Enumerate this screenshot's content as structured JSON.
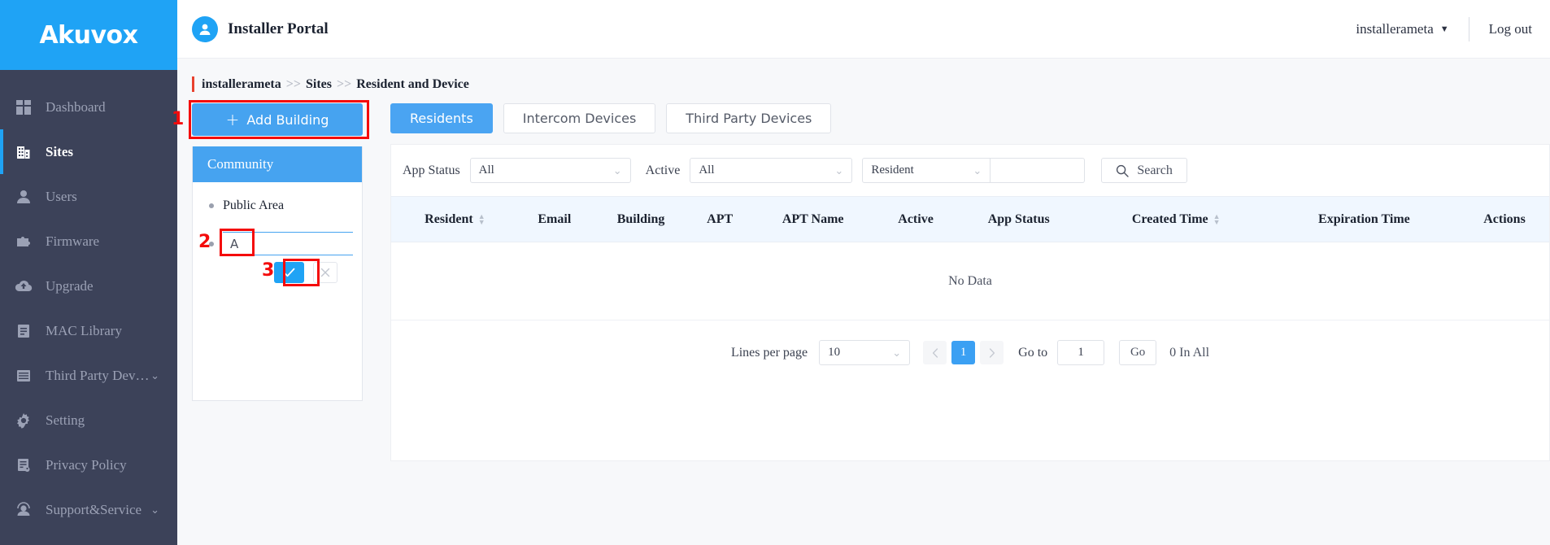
{
  "brand": {
    "logo": "Akuvox",
    "logo_bg": "#1fa3f5",
    "sidebar_bg": "#3c4259",
    "accent": "#46a3f0",
    "highlight": "#f40b0b"
  },
  "sidebar": {
    "items": [
      {
        "label": "Dashboard",
        "icon": "dashboard-icon",
        "active": false,
        "caret": ""
      },
      {
        "label": "Sites",
        "icon": "building-icon",
        "active": true,
        "caret": ""
      },
      {
        "label": "Users",
        "icon": "user-icon",
        "active": false,
        "caret": ""
      },
      {
        "label": "Firmware",
        "icon": "puzzle-icon",
        "active": false,
        "caret": ""
      },
      {
        "label": "Upgrade",
        "icon": "cloud-upload-icon",
        "active": false,
        "caret": ""
      },
      {
        "label": "MAC Library",
        "icon": "list-doc-icon",
        "active": false,
        "caret": ""
      },
      {
        "label": "Third Party Dev…",
        "icon": "grid-list-icon",
        "active": false,
        "caret": "⌄"
      },
      {
        "label": "Setting",
        "icon": "gear-icon",
        "active": false,
        "caret": ""
      },
      {
        "label": "Privacy Policy",
        "icon": "policy-doc-icon",
        "active": false,
        "caret": ""
      },
      {
        "label": "Support&Service",
        "icon": "headset-icon",
        "active": false,
        "caret": "⌄"
      }
    ]
  },
  "topbar": {
    "portal_title": "Installer Portal",
    "avatar_icon": "person-avatar-icon",
    "user_name": "installerameta",
    "caret": "▼",
    "logout": "Log out"
  },
  "breadcrumb": {
    "root": "installerameta",
    "sep": ">>",
    "middle": "Sites",
    "current": "Resident and Device"
  },
  "left": {
    "add_building_label": "Add Building",
    "add_building_plus": "+",
    "tree_header": "Community",
    "nodes": [
      {
        "label": "Public Area"
      }
    ],
    "edit_value": "A",
    "confirm_icon": "check-icon",
    "cancel_icon": "close-icon"
  },
  "steps": [
    {
      "number": "1"
    },
    {
      "number": "2"
    },
    {
      "number": "3"
    }
  ],
  "tabs": [
    {
      "label": "Residents",
      "active": true
    },
    {
      "label": "Intercom Devices",
      "active": false
    },
    {
      "label": "Third Party Devices",
      "active": false
    }
  ],
  "filters": {
    "app_status_label": "App Status",
    "app_status_value": "All",
    "active_label": "Active",
    "active_value": "All",
    "resident_value": "Resident",
    "keyword_value": "",
    "search_label": "Search",
    "search_icon": "search-icon",
    "chevron": "⌄"
  },
  "table": {
    "columns": [
      {
        "label": "Resident",
        "sortable": true
      },
      {
        "label": "Email",
        "sortable": false
      },
      {
        "label": "Building",
        "sortable": false
      },
      {
        "label": "APT",
        "sortable": false
      },
      {
        "label": "APT Name",
        "sortable": false
      },
      {
        "label": "Active",
        "sortable": false
      },
      {
        "label": "App Status",
        "sortable": false
      },
      {
        "label": "Created Time",
        "sortable": true
      },
      {
        "label": "Expiration Time",
        "sortable": false
      },
      {
        "label": "Actions",
        "sortable": false
      }
    ],
    "rows": [],
    "empty_text": "No Data"
  },
  "pagination": {
    "lines_label": "Lines per page",
    "lines_value": "10",
    "prev_icon": "chevron-left-icon",
    "next_icon": "chevron-right-icon",
    "current_page": "1",
    "goto_label": "Go to",
    "goto_value": "1",
    "go_label": "Go",
    "total_label": "0 In All",
    "chevron": "⌄"
  }
}
